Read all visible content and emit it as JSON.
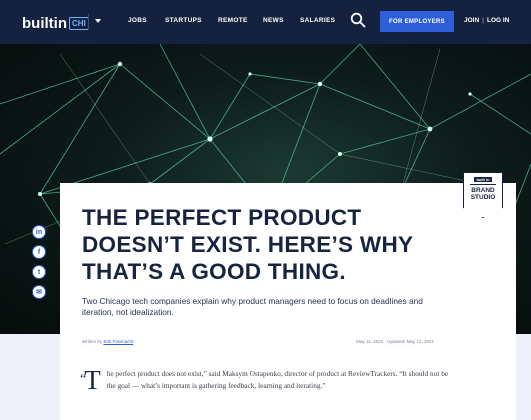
{
  "nav": {
    "logo_text": "builtin",
    "logo_city": "CHI",
    "links": [
      "JOBS",
      "STARTUPS",
      "REMOTE",
      "NEWS",
      "SALARIES"
    ],
    "employers_label": "FOR EMPLOYERS",
    "join_label": "JOIN",
    "login_label": "LOG IN",
    "separator": "|"
  },
  "badge": {
    "logo": "built in",
    "line1": "BRAND",
    "line2": "STUDIO"
  },
  "share": {
    "linkedin": "in",
    "facebook": "f",
    "twitter": "t",
    "email": "✉"
  },
  "article": {
    "headline": "The Perfect Product Doesn’t Exist. Here’s Why That’s a Good Thing.",
    "dek": "Two Chicago tech companies explain why product managers need to focus on deadlines and iteration, not idealization.",
    "written_by": "Written by",
    "author": "Erik Fassnacht",
    "dates": "May 11, 2021 · Updated: May 12, 2021",
    "quote_mark": "“",
    "dropcap": "T",
    "lede": "he perfect product does not exist,” said Maksym Ostapenko, director of product at ReviewTrackers. “It should not be the goal — what’s important is gathering feedback, learning and iterating.”"
  },
  "colors": {
    "nav_bg": "#14213f",
    "accent": "#2f5fd8",
    "headline": "#17233f",
    "hero_lines": "#5fd6b0"
  }
}
